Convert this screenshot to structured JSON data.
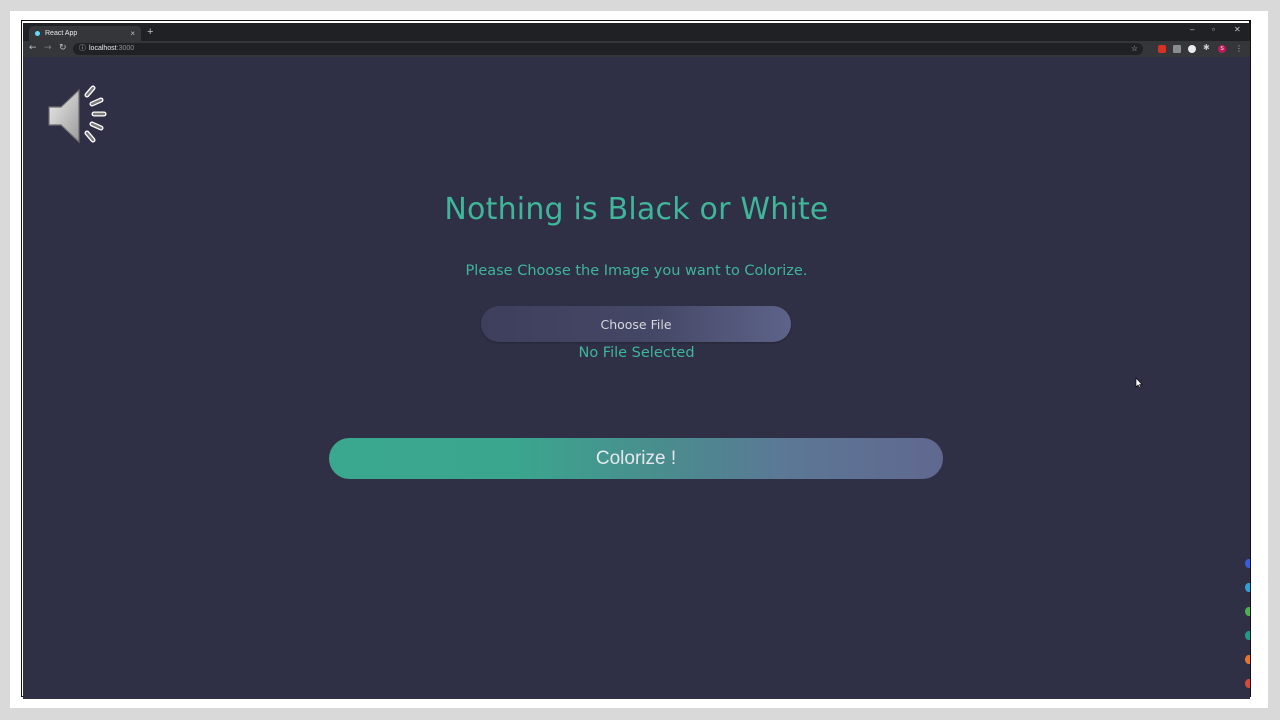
{
  "browser": {
    "tab_title": "React App",
    "tab_close": "×",
    "new_tab": "+",
    "window_controls": [
      "–",
      "▫",
      "✕"
    ],
    "address_host": "localhost",
    "address_port": ":3000",
    "extension_badge_letter": "S",
    "extension_badge_letter2": "S"
  },
  "page": {
    "title": "Nothing is Black or White",
    "subtitle": "Please Choose the Image you want to Colorize.",
    "choose_file_label": "Choose File",
    "file_status": "No File Selected",
    "colorize_label": "Colorize !"
  },
  "colors": {
    "page_background": "#2f3046",
    "accent_teal": "#3fb59a",
    "button_gradient_end": "#60688f"
  }
}
